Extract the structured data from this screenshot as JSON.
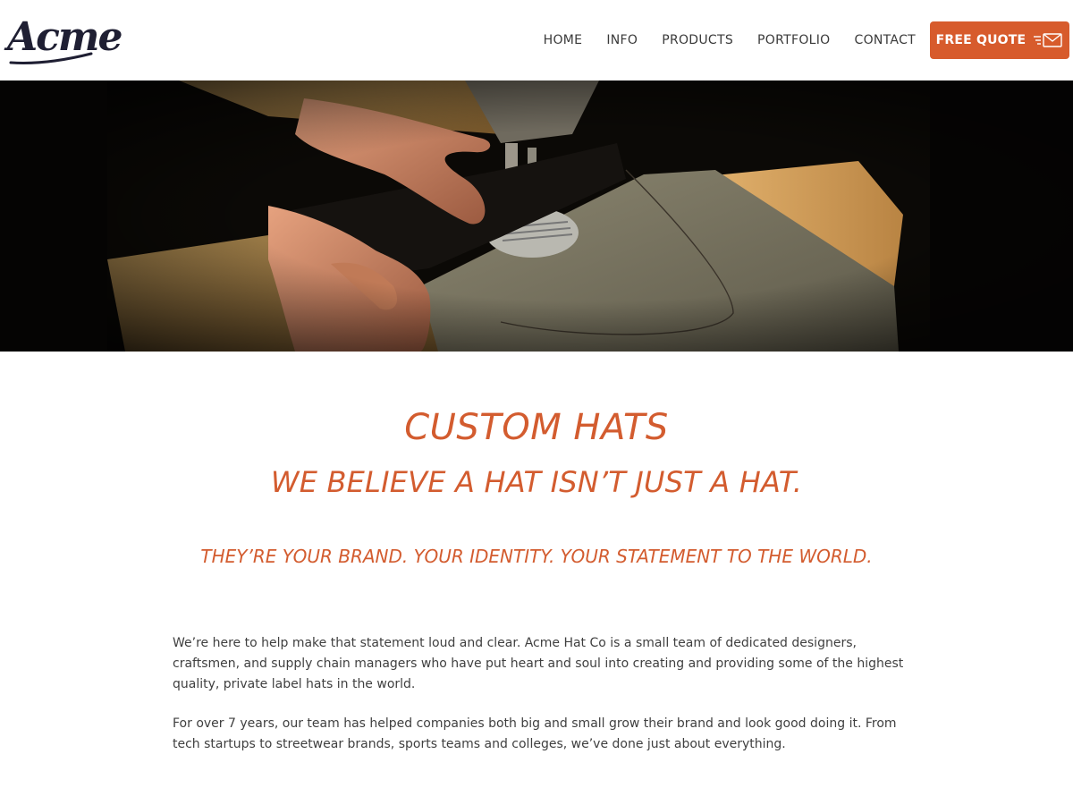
{
  "header": {
    "logo_text": "Acme",
    "nav": [
      "HOME",
      "INFO",
      "PRODUCTS",
      "PORTFOLIO",
      "CONTACT"
    ],
    "quote_button": "FREE QUOTE",
    "quote_icon": "envelope-icon"
  },
  "hero": {
    "image_subject": "hands guiding dark fabric through an industrial sewing machine"
  },
  "main": {
    "title": "CUSTOM HATS",
    "subtitle": "WE BELIEVE A HAT ISN’T JUST A HAT.",
    "tagline": "THEY’RE YOUR BRAND. YOUR IDENTITY. YOUR STATEMENT TO THE WORLD.",
    "paragraphs": [
      "We’re here to help make that statement loud and clear. Acme Hat Co is a small team of dedicated designers, craftsmen, and supply chain managers who have put heart and soul into creating and providing some of the highest quality, private label hats in the world.",
      "For over 7 years, our team has helped companies both big and small grow their brand and look good doing it. From tech startups to streetwear brands, sports teams and colleges, we’ve done just about everything."
    ]
  },
  "colors": {
    "accent": "#d75b2c",
    "heading": "#d35c2f",
    "body_text": "#3f3f3f",
    "logo": "#1f1f33"
  }
}
